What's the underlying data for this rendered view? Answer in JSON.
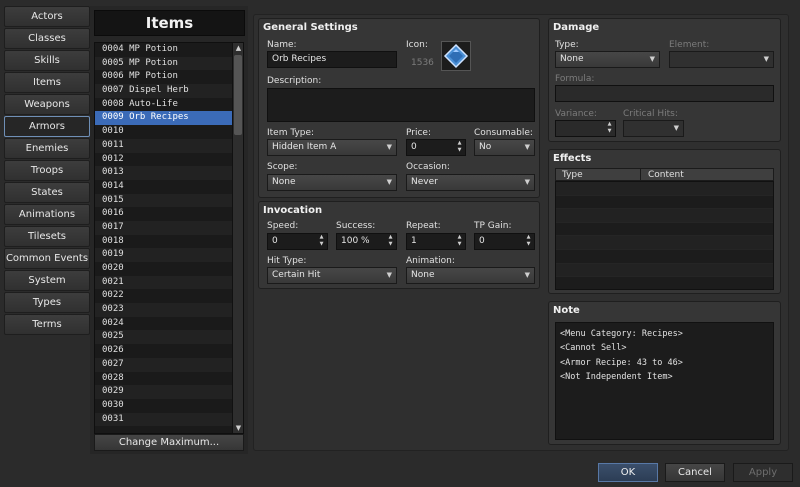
{
  "categories": [
    "Actors",
    "Classes",
    "Skills",
    "Items",
    "Weapons",
    "Armors",
    "Enemies",
    "Troops",
    "States",
    "Animations",
    "Tilesets",
    "Common Events",
    "System",
    "Types",
    "Terms"
  ],
  "active_category": "Armors",
  "list": {
    "title": "Items",
    "rows": [
      "0004 MP Potion",
      "0005 MP Potion",
      "0006 MP Potion",
      "0007 Dispel Herb",
      "0008 Auto-Life",
      "0009 Orb Recipes",
      "0010",
      "0011",
      "0012",
      "0013",
      "0014",
      "0015",
      "0016",
      "0017",
      "0018",
      "0019",
      "0020",
      "0021",
      "0022",
      "0023",
      "0024",
      "0025",
      "0026",
      "0027",
      "0028",
      "0029",
      "0030",
      "0031"
    ],
    "selected_index": 5,
    "change_max": "Change Maximum..."
  },
  "general": {
    "title": "General Settings",
    "name_label": "Name:",
    "name": "Orb Recipes",
    "icon_label": "Icon:",
    "icon_index": "1536",
    "desc_label": "Description:",
    "description": "",
    "item_type_label": "Item Type:",
    "item_type": "Hidden Item A",
    "price_label": "Price:",
    "price": "0",
    "consumable_label": "Consumable:",
    "consumable": "No",
    "scope_label": "Scope:",
    "scope": "None",
    "occasion_label": "Occasion:",
    "occasion": "Never"
  },
  "invocation": {
    "title": "Invocation",
    "speed_label": "Speed:",
    "speed": "0",
    "success_label": "Success:",
    "success": "100 %",
    "repeat_label": "Repeat:",
    "repeat": "1",
    "tp_label": "TP Gain:",
    "tp": "0",
    "hit_label": "Hit Type:",
    "hit": "Certain Hit",
    "anim_label": "Animation:",
    "anim": "None"
  },
  "damage": {
    "title": "Damage",
    "type_label": "Type:",
    "type": "None",
    "element_label": "Element:",
    "element": "",
    "formula_label": "Formula:",
    "formula": "",
    "variance_label": "Variance:",
    "variance": "",
    "crit_label": "Critical Hits:",
    "crit": ""
  },
  "effects": {
    "title": "Effects",
    "col_type": "Type",
    "col_content": "Content"
  },
  "note": {
    "title": "Note",
    "lines": [
      "<Menu Category: Recipes>",
      "<Cannot Sell>",
      "<Armor Recipe: 43 to 46>",
      "<Not Independent Item>"
    ]
  },
  "buttons": {
    "ok": "OK",
    "cancel": "Cancel",
    "apply": "Apply"
  },
  "colors": {
    "selection": "#3b6bb8",
    "accent": "#6f8fb6",
    "icon_gem": "#4a8fd6"
  },
  "icons": {
    "item_icon": "blue-gem-icon"
  }
}
